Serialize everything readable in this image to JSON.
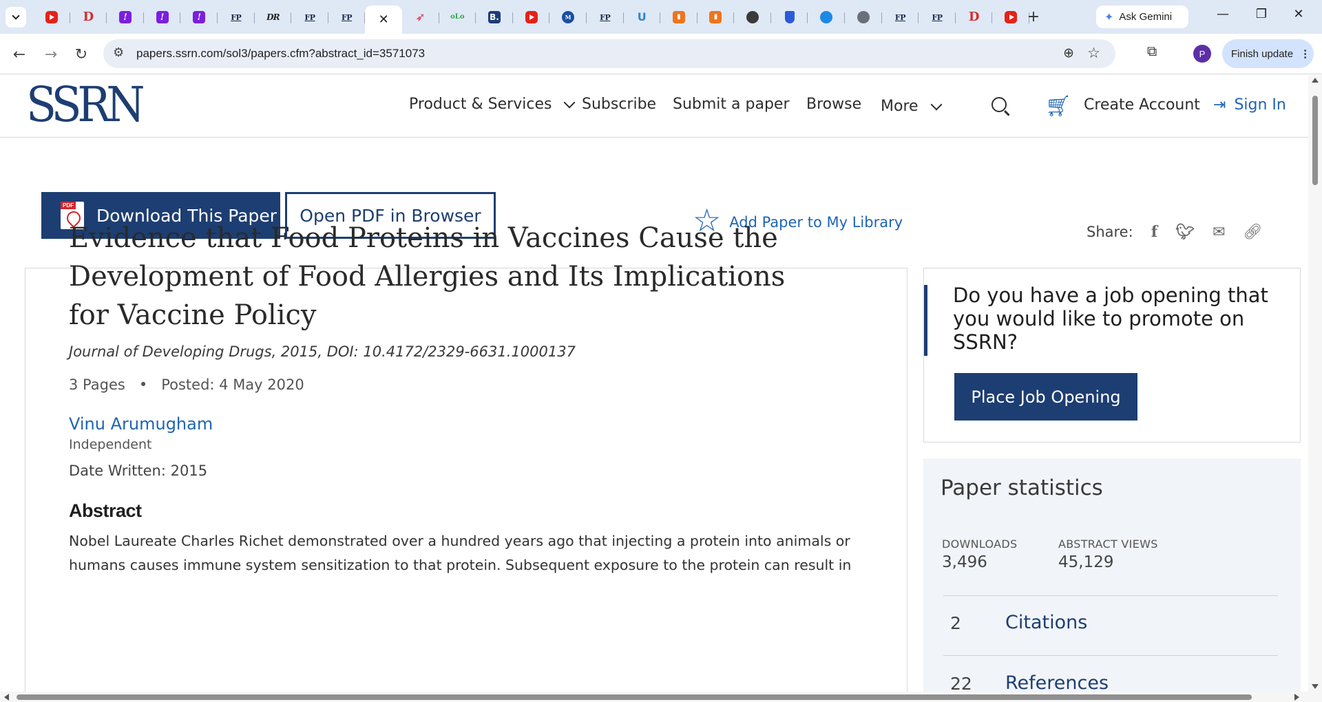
{
  "browser": {
    "tabs": [
      {
        "icon": "youtube-icon",
        "glyph": "",
        "cls": "yt"
      },
      {
        "icon": "d-icon",
        "glyph": "D",
        "cls": "d"
      },
      {
        "icon": "purple-exclaim-icon",
        "glyph": "!",
        "cls": "purple"
      },
      {
        "icon": "purple-exclaim-icon",
        "glyph": "!",
        "cls": "purple"
      },
      {
        "icon": "purple-exclaim-icon",
        "glyph": "!",
        "cls": "purple"
      },
      {
        "icon": "fp-icon",
        "glyph": "FP",
        "cls": "fp"
      },
      {
        "icon": "dr-icon",
        "glyph": "DR",
        "cls": "dr"
      },
      {
        "icon": "fp-icon",
        "glyph": "FP",
        "cls": "fp"
      },
      {
        "icon": "fp-icon",
        "glyph": "FP",
        "cls": "fp"
      },
      {
        "icon": "close-icon",
        "glyph": "✕",
        "cls": "active"
      },
      {
        "icon": "bird-icon",
        "glyph": "➶",
        "cls": "bird"
      },
      {
        "icon": "olo-icon",
        "glyph": "oLo",
        "cls": "olo"
      },
      {
        "icon": "b-icon",
        "glyph": "B.",
        "cls": "b"
      },
      {
        "icon": "youtube-icon",
        "glyph": "",
        "cls": "yt"
      },
      {
        "icon": "circle-logo-icon",
        "glyph": "M",
        "cls": "circ"
      },
      {
        "icon": "fp-icon",
        "glyph": "FP",
        "cls": "fp"
      },
      {
        "icon": "u-icon",
        "glyph": "U",
        "cls": "u"
      },
      {
        "icon": "bookmark-orange-icon",
        "glyph": "▮",
        "cls": "orange"
      },
      {
        "icon": "bookmark-orange-icon",
        "glyph": "▮",
        "cls": "orange"
      },
      {
        "icon": "globe-dark-icon",
        "glyph": "",
        "cls": "globe"
      },
      {
        "icon": "shield-icon",
        "glyph": "",
        "cls": "shield"
      },
      {
        "icon": "blue-circle-icon",
        "glyph": "",
        "cls": "blue"
      },
      {
        "icon": "globe-icon",
        "glyph": "",
        "cls": "grey"
      },
      {
        "icon": "fp-icon",
        "glyph": "FP",
        "cls": "fp"
      },
      {
        "icon": "fp-icon",
        "glyph": "FP",
        "cls": "fp"
      },
      {
        "icon": "d-icon",
        "glyph": "D",
        "cls": "d"
      },
      {
        "icon": "youtube-icon",
        "glyph": "",
        "cls": "yt"
      }
    ],
    "new_tab": "+",
    "ask_gemini": "Ask Gemini",
    "url": "papers.ssrn.com/sol3/papers.cfm?abstract_id=3571073",
    "profile_initial": "P",
    "finish_update": "Finish update"
  },
  "header": {
    "logo": "SSRN",
    "nav": {
      "products": "Product & Services",
      "subscribe": "Subscribe",
      "submit": "Submit a paper",
      "browse": "Browse",
      "more": "More"
    },
    "create_account": "Create Account",
    "sign_in": "Sign In"
  },
  "actions": {
    "download": "Download This Paper",
    "open_pdf": "Open PDF in Browser",
    "add_library": "Add Paper to My Library",
    "share_label": "Share:"
  },
  "paper": {
    "title": "Evidence that Food Proteins in Vaccines Cause the Development of Food Allergies and Its Implications for Vaccine Policy",
    "journal": "Journal of Developing Drugs, 2015, DOI: 10.4172/2329-6631.1000137",
    "pages": "3 Pages",
    "separator": "•",
    "posted": "Posted: 4 May 2020",
    "author": "Vinu Arumugham",
    "affiliation": "Independent",
    "date_written": "Date Written: 2015",
    "abstract_heading": "Abstract",
    "abstract_text": "Nobel Laureate Charles Richet demonstrated over a hundred years ago that injecting a protein into animals or humans causes immune system sensitization to that protein. Subsequent exposure to the protein can result in"
  },
  "job": {
    "text": "Do you have a job opening that you would like to promote on SSRN?",
    "button": "Place Job Opening"
  },
  "stats": {
    "heading": "Paper statistics",
    "downloads_label": "DOWNLOADS",
    "downloads_value": "3,496",
    "views_label": "ABSTRACT VIEWS",
    "views_value": "45,129",
    "citations_count": "2",
    "citations_label": "Citations",
    "references_count": "22",
    "references_label": "References"
  },
  "colors": {
    "brand_navy": "#1d3e72",
    "link_blue": "#1e64b4"
  }
}
